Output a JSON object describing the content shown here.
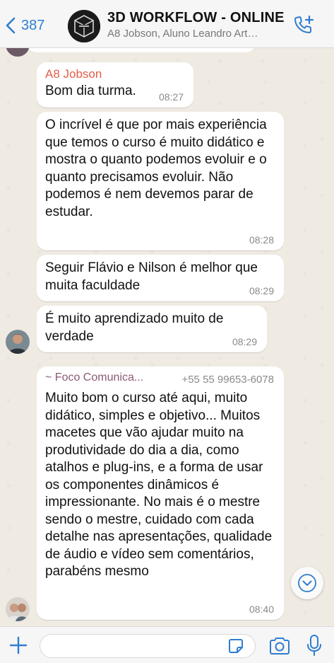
{
  "header": {
    "back_count": "387",
    "title": "3D WORKFLOW - ONLINE",
    "subtitle": "A8 Jobson, Aluno Leandro Artemi..."
  },
  "messages": [
    {
      "sender": "A8 Jobson",
      "text": "Bom dia turma.",
      "time": "08:27"
    },
    {
      "text": "O incrível é que por mais experiência que temos o curso é muito didático e mostra o quanto podemos evoluir e o quanto precisamos evoluir. Não podemos é nem devemos parar de estudar.",
      "time": "08:28"
    },
    {
      "text": "Seguir Flávio e Nilson é melhor que muita faculdade",
      "time": "08:29"
    },
    {
      "text": "É muito aprendizado muito de verdade",
      "time": "08:29"
    },
    {
      "sender": "~ Foco Comunica...",
      "phone": "+55 55 99653-6078",
      "text": "Muito bom o curso até aqui, muito didático, simples e objetivo... Muitos macetes que vão ajudar muito na produtividade do dia a dia, como atalhos e plug-ins, e a forma de usar os componentes dinâmicos é impressionante. No mais é o mestre sendo o mestre, cuidado com cada detalhe nas apresentações, qualidade de áudio e vídeo sem comentários, parabéns mesmo",
      "time": "08:40"
    }
  ],
  "input": {
    "placeholder": ""
  },
  "icons": {
    "back": "chevron-left-icon",
    "call": "add-call-icon",
    "scroll": "chevron-down-icon",
    "plus": "plus-icon",
    "sticker": "sticker-icon",
    "camera": "camera-icon",
    "mic": "microphone-icon"
  },
  "colors": {
    "accent": "#2f7dd1",
    "sender_a8": "#e35d4a",
    "sender_foco": "#8d5a74",
    "chat_bg": "#efeae2"
  }
}
